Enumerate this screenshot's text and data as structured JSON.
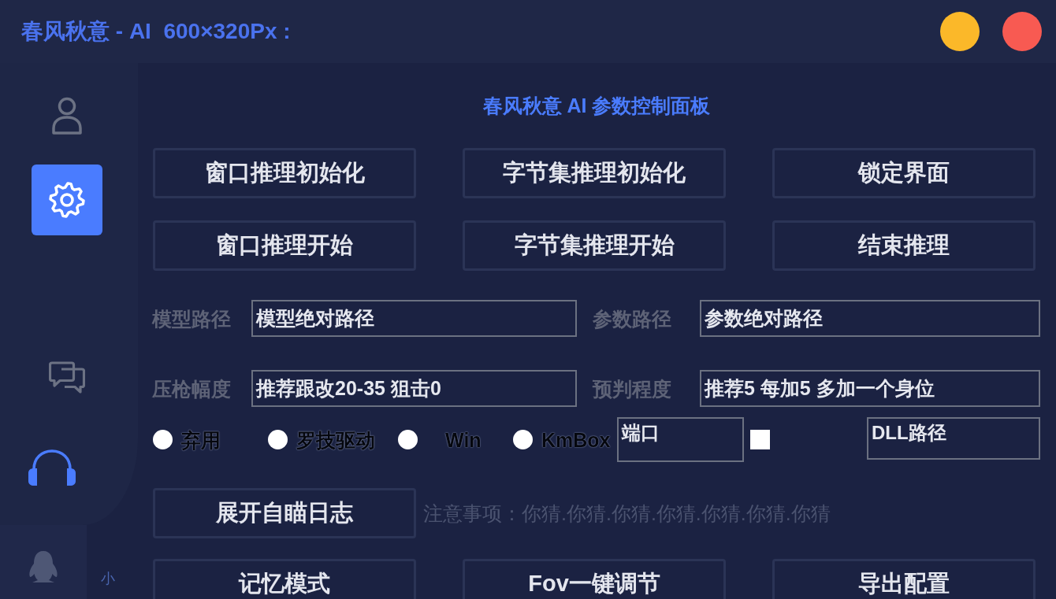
{
  "window": {
    "title": "春风秋意 - AI  600×320Px :"
  },
  "sidebar": {
    "items": [
      {
        "kind": "user",
        "selected": false
      },
      {
        "kind": "settings",
        "selected": true
      },
      {
        "kind": "chat",
        "selected": false
      },
      {
        "kind": "support",
        "selected": false
      }
    ],
    "footer_text": "小"
  },
  "panel": {
    "title": "春风秋意 AI 参数控制面板",
    "action_buttons": [
      "窗口推理初始化",
      "字节集推理初始化",
      "锁定界面",
      "窗口推理开始",
      "字节集推理开始",
      "结束推理"
    ],
    "fields": [
      {
        "label": "模型路径",
        "value": "模型绝对路径"
      },
      {
        "label": "参数路径",
        "value": "参数绝对路径"
      },
      {
        "label": "压枪幅度",
        "value": "推荐跟改20-35 狙击0"
      },
      {
        "label": "预判程度",
        "value": "推荐5 每加5 多加一个身位"
      }
    ],
    "drivers": [
      {
        "label": "弃用",
        "selected": false
      },
      {
        "label": "罗技驱动",
        "selected": false
      },
      {
        "label": "Win",
        "selected": false
      },
      {
        "label": "KmBox",
        "selected": false
      }
    ],
    "port_field": {
      "value": "端口"
    },
    "checkbox": {
      "checked": false
    },
    "dll_field": {
      "value": "DLL路径"
    },
    "log_button": "展开自瞄日志",
    "notice": "注意事项：你猜.你猜.你猜.你猜.你猜.你猜.你猜",
    "bottom_buttons": [
      "记忆模式",
      "Fov一键调节",
      "导出配置"
    ]
  }
}
